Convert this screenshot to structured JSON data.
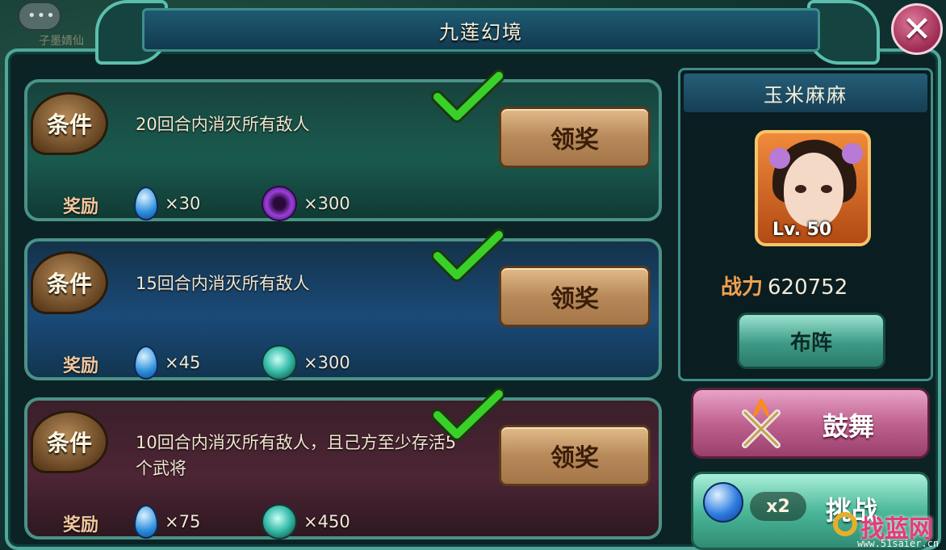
{
  "background": {
    "caption": "子墨婧仙"
  },
  "window": {
    "title": "九莲幻境",
    "close_icon": "close-icon"
  },
  "tasks": [
    {
      "badge": "条件",
      "condition": "20回合内消灭所有敌人",
      "claim_label": "领奖",
      "reward_label": "奖励",
      "rewards": [
        {
          "icon": "blue-drop-icon",
          "qty": "×30"
        },
        {
          "icon": "purple-orb-icon",
          "qty": "×300"
        }
      ]
    },
    {
      "badge": "条件",
      "condition": "15回合内消灭所有敌人",
      "claim_label": "领奖",
      "reward_label": "奖励",
      "rewards": [
        {
          "icon": "blue-drop-icon",
          "qty": "×45"
        },
        {
          "icon": "teal-orb-icon",
          "qty": "×300"
        }
      ]
    },
    {
      "badge": "条件",
      "condition": "10回合内消灭所有敌人，且己方至少存活5个武将",
      "claim_label": "领奖",
      "reward_label": "奖励",
      "rewards": [
        {
          "icon": "blue-drop-icon",
          "qty": "×75"
        },
        {
          "icon": "teal-orb-icon",
          "qty": "×450"
        }
      ]
    }
  ],
  "player": {
    "name": "玉米麻麻",
    "level": "Lv. 50",
    "power_label": "战力",
    "power_value": "620752",
    "formation_label": "布阵"
  },
  "actions": {
    "inspire_label": "鼓舞",
    "challenge_label": "挑战",
    "challenge_count": "x2"
  },
  "watermark": {
    "brand": "找蓝网",
    "url": "www.51saier.cn"
  },
  "colors": {
    "frame": "#4fa89a",
    "claim_button": "#c79a68",
    "inspire_button": "#c0628f",
    "challenge_button": "#4cb89a",
    "check": "#39d02a"
  }
}
